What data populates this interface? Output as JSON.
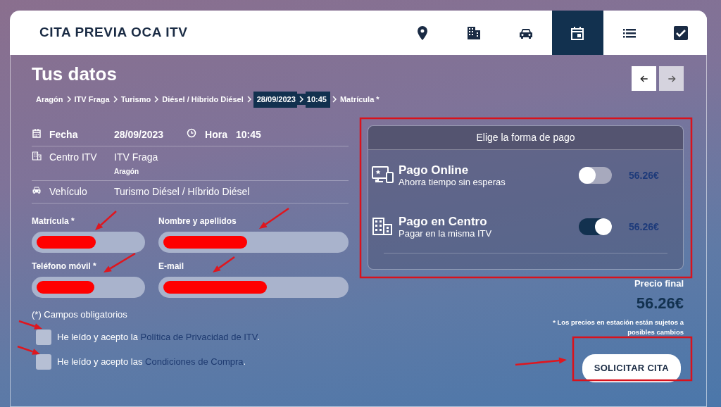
{
  "header": {
    "title": "CITA PREVIA OCA ITV",
    "steps": [
      {
        "kind": "location",
        "selected": false
      },
      {
        "kind": "building",
        "selected": false
      },
      {
        "kind": "car",
        "selected": false
      },
      {
        "kind": "calendar",
        "selected": true
      },
      {
        "kind": "list",
        "selected": false
      },
      {
        "kind": "check",
        "selected": false
      }
    ]
  },
  "page_title": "Tus datos",
  "nav_buttons": [
    {
      "kind": "back",
      "disabled": false
    },
    {
      "kind": "forward",
      "disabled": true
    }
  ],
  "breadcrumb": [
    {
      "text": "Aragón",
      "highlighted": false
    },
    {
      "text": "ITV Fraga",
      "highlighted": false
    },
    {
      "text": "Turismo",
      "highlighted": false
    },
    {
      "text": "Diésel / Híbrido Diésel",
      "highlighted": false
    },
    {
      "text": "28/09/2023",
      "highlighted": true
    },
    {
      "text": "10:45",
      "highlighted": true
    },
    {
      "text": "Matrícula *",
      "highlighted": false
    }
  ],
  "summary": {
    "date_label": "Fecha",
    "date": "28/09/2023",
    "time_label": "Hora",
    "time": "10:45",
    "center_label": "Centro ITV",
    "center": "ITV Fraga",
    "center_region": "Aragón",
    "vehicle_label": "Vehículo",
    "vehicle": "Turismo Diésel / Híbrido Diésel"
  },
  "fields": [
    {
      "label": "Matrícula *",
      "redacted": true
    },
    {
      "label": "Nombre y apellidos",
      "redacted": true
    },
    {
      "label": "Teléfono móvil *",
      "redacted": true
    },
    {
      "label": "E-mail",
      "redacted": true
    }
  ],
  "required_note": "(*) Campos obligatorios",
  "consents": [
    {
      "text": "He leído y acepto la",
      "link": "Política de Privacidad de ITV",
      "after": ".",
      "checked": false
    },
    {
      "text": "He leído y acepto las",
      "link": "Condiciones de Compra",
      "after": ".",
      "checked": false
    }
  ],
  "payment": {
    "title": "Elige la forma de pago",
    "options": [
      {
        "kind": "online",
        "name": "Pago Online",
        "description": "Ahorra tiempo sin esperas",
        "on": false,
        "price": "56.26€"
      },
      {
        "kind": "center",
        "name": "Pago en Centro",
        "description": "Pagar en la misma ITV",
        "on": true,
        "price": "56.26€"
      }
    ]
  },
  "final_price_label": "Precio final",
  "final_price": "56.26€",
  "price_note": "* Los precios en estación están sujetos a posibles cambios",
  "submit_button": "SOLICITAR CITA"
}
